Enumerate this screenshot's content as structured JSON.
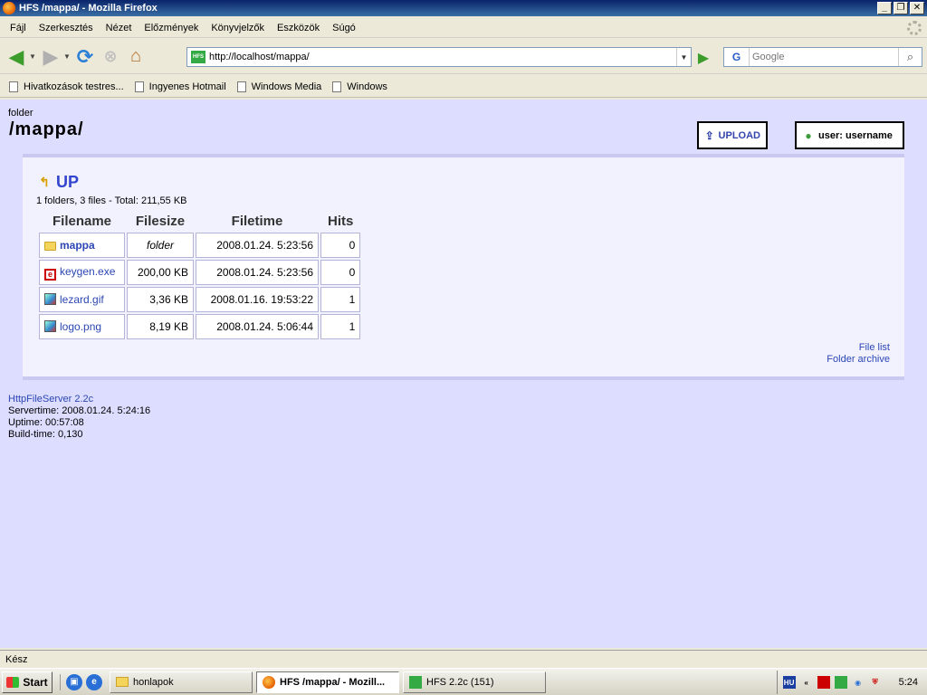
{
  "window": {
    "title": "HFS /mappa/ - Mozilla Firefox"
  },
  "menu": [
    "Fájl",
    "Szerkesztés",
    "Nézet",
    "Előzmények",
    "Könyvjelzők",
    "Eszközök",
    "Súgó"
  ],
  "nav": {
    "url": "http://localhost/mappa/",
    "search_engine": "G",
    "search_placeholder": "Google"
  },
  "bookmarks": [
    "Hivatkozások testres...",
    "Ingyenes Hotmail",
    "Windows Media",
    "Windows"
  ],
  "page": {
    "folder_label": "folder",
    "path": "/mappa/",
    "upload_label": "UPLOAD",
    "user_label": "user: username",
    "up_label": "UP",
    "summary": "1 folders, 3 files - Total: 211,55 KB",
    "columns": {
      "name": "Filename",
      "size": "Filesize",
      "time": "Filetime",
      "hits": "Hits"
    },
    "files": [
      {
        "name": "mappa",
        "size": "folder",
        "time": "2008.01.24. 5:23:56",
        "hits": "0"
      },
      {
        "name": "keygen.exe",
        "size": "200,00 KB",
        "time": "2008.01.24. 5:23:56",
        "hits": "0"
      },
      {
        "name": "lezard.gif",
        "size": "3,36 KB",
        "time": "2008.01.16. 19:53:22",
        "hits": "1"
      },
      {
        "name": "logo.png",
        "size": "8,19 KB",
        "time": "2008.01.24. 5:06:44",
        "hits": "1"
      }
    ],
    "file_list_link": "File list",
    "folder_archive_link": "Folder archive",
    "footer": {
      "server_link": "HttpFileServer 2.2c",
      "servertime": "Servertime: 2008.01.24. 5:24:16",
      "uptime": "Uptime: 00:57:08",
      "buildtime": "Build-time: 0,130"
    }
  },
  "status": {
    "text": "Kész"
  },
  "taskbar": {
    "start": "Start",
    "tasks": [
      "honlapok",
      "HFS /mappa/ - Mozill...",
      "HFS 2.2c (151)"
    ],
    "tray_lang": "HU",
    "clock": "5:24"
  },
  "colors": {
    "page_bg": "#DDDDFF",
    "link": "#2C46B4",
    "titlebar": "#0A246A"
  }
}
